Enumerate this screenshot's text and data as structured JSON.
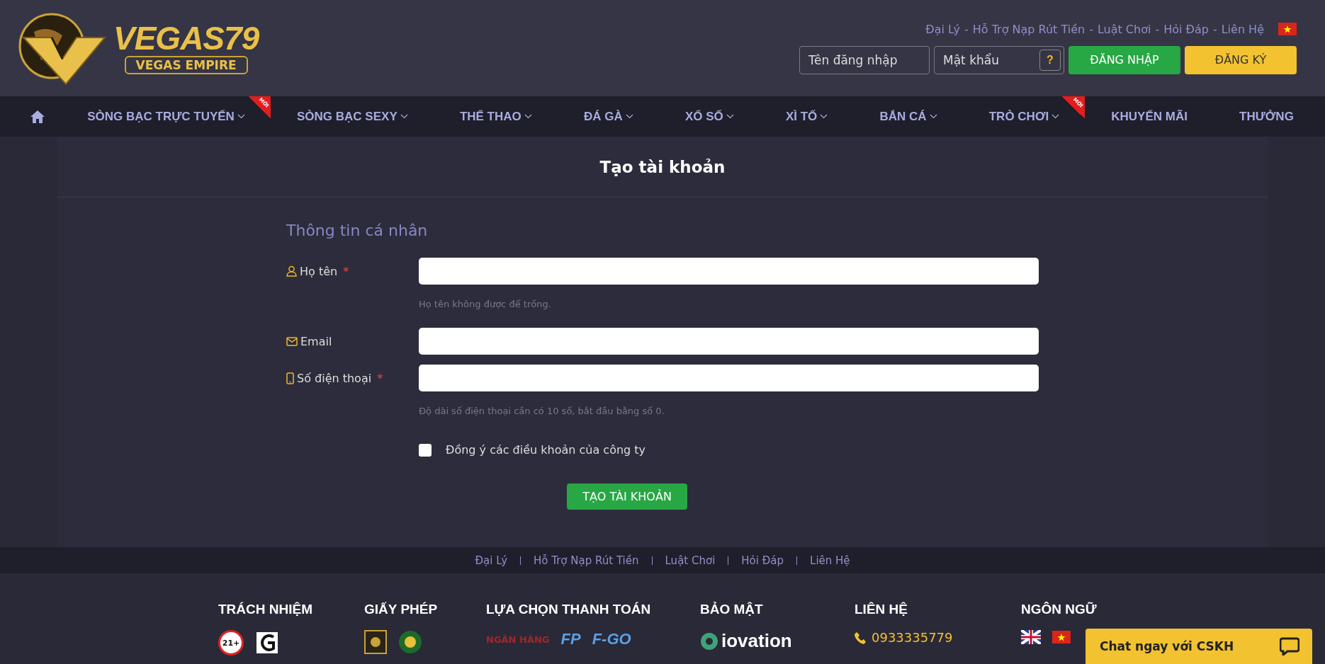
{
  "logo": {
    "title": "VEGAS79",
    "subtitle": "VEGAS EMPIRE"
  },
  "top_links": [
    {
      "label": "Đại Lý"
    },
    {
      "separator": "-",
      "label": "Hỗ Trợ Nạp Rút Tiền"
    },
    {
      "separator": "-",
      "label": "Luật Chơi"
    },
    {
      "separator": "-",
      "label": "Hỏi Đáp"
    },
    {
      "separator": "-",
      "label": "Liên Hệ"
    }
  ],
  "login": {
    "username_placeholder": "Tên đăng nhập",
    "password_placeholder": "Mật khẩu",
    "help": "?",
    "login_button": "ĐĂNG NHẬP",
    "register_button": "ĐĂNG KÝ"
  },
  "nav": [
    {
      "label": "SÒNG BẠC TRỰC TUYẾN",
      "dropdown": true,
      "badge": "MỚI"
    },
    {
      "label": "SÒNG BẠC SEXY",
      "dropdown": true
    },
    {
      "label": "THỂ THAO",
      "dropdown": true
    },
    {
      "label": "ĐÁ GÀ",
      "dropdown": true
    },
    {
      "label": "XỔ SỐ",
      "dropdown": true
    },
    {
      "label": "XÌ TỐ",
      "dropdown": true
    },
    {
      "label": "BẮN CÁ",
      "dropdown": true
    },
    {
      "label": "TRÒ CHƠI",
      "dropdown": true,
      "badge": "MỚI"
    },
    {
      "label": "KHUYẾN MÃI",
      "dropdown": false
    },
    {
      "label": "THƯỞNG",
      "dropdown": false
    }
  ],
  "form": {
    "title": "Tạo tài khoản",
    "section": "Thông tin cá nhân",
    "fields": [
      {
        "kind": "person",
        "label": "Họ tên",
        "required": true,
        "hint": "Họ tên không được để trống."
      },
      {
        "kind": "mail",
        "label": "Email",
        "required": false
      },
      {
        "kind": "phone",
        "label": "Số điện thoại",
        "required": true,
        "hint": "Độ dài số điện thoại cần có 10 số, bắt đầu bằng số 0."
      }
    ],
    "required_mark": "*",
    "agree": {
      "label": "Đồng ý các điều khoản của công ty",
      "checked": false
    },
    "submit": "TẠO TÀI KHOẢN"
  },
  "footer_links": [
    {
      "label": "Đại Lý"
    },
    {
      "label": "Hỗ Trợ Nạp Rút Tiền"
    },
    {
      "label": "Luật Chơi"
    },
    {
      "label": "Hỏi Đáp"
    },
    {
      "label": "Liên Hệ"
    }
  ],
  "footer": [
    {
      "title": "TRÁCH NHIỆM",
      "items": [
        {
          "kind": "age",
          "text": "21+"
        },
        {
          "kind": "gc"
        }
      ]
    },
    {
      "title": "GIẤY PHÉP",
      "items": [
        {
          "kind": "seal"
        },
        {
          "kind": "emblem"
        }
      ]
    },
    {
      "title": "LỰA CHỌN THANH TOÁN",
      "items": [
        {
          "kind": "bank",
          "text": "NGÂN HÀNG"
        },
        {
          "kind": "pay",
          "text": "FP"
        },
        {
          "kind": "pay",
          "text": "F-GO"
        }
      ]
    },
    {
      "title": "BẢO MẬT",
      "items": [
        {
          "kind": "iovation",
          "text": "iovation"
        }
      ]
    },
    {
      "title": "LIÊN HỆ",
      "items": [
        {
          "kind": "phone",
          "text": "0933335779"
        }
      ]
    },
    {
      "title": "NGÔN NGỮ",
      "items": [
        {
          "kind": "flag-uk"
        },
        {
          "kind": "flag-vn"
        }
      ]
    }
  ],
  "chat": {
    "label": "Chat ngay với CSKH"
  }
}
